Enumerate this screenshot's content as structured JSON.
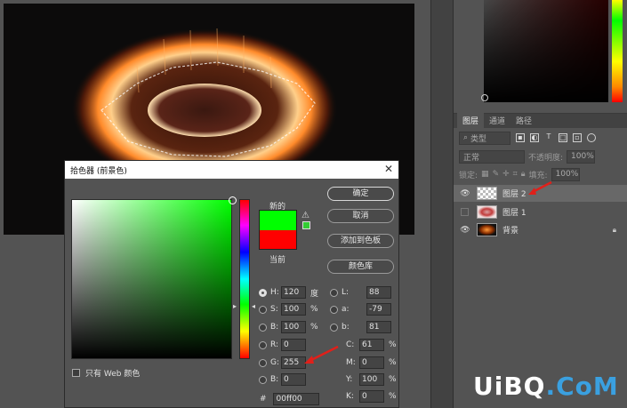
{
  "dialog": {
    "title": "拾色器 (前景色)",
    "close": "✕",
    "label_new": "新的",
    "label_current": "当前",
    "buttons": {
      "ok": "确定",
      "cancel": "取消",
      "add_to_swatches": "添加到色板",
      "color_libraries": "颜色库"
    },
    "web_only_label": "只有 Web 颜色",
    "new_color": "#00ff00",
    "current_color": "#ff0000",
    "fields": {
      "H": {
        "label": "H:",
        "value": "120",
        "unit": "度"
      },
      "S": {
        "label": "S:",
        "value": "100",
        "unit": "%"
      },
      "B": {
        "label": "B:",
        "value": "100",
        "unit": "%"
      },
      "R": {
        "label": "R:",
        "value": "0"
      },
      "G": {
        "label": "G:",
        "value": "255"
      },
      "Bl": {
        "label": "B:",
        "value": "0"
      },
      "L": {
        "label": "L:",
        "value": "88"
      },
      "a": {
        "label": "a:",
        "value": "-79"
      },
      "b": {
        "label": "b:",
        "value": "81"
      },
      "C": {
        "label": "C:",
        "value": "61",
        "unit": "%"
      },
      "M": {
        "label": "M:",
        "value": "0",
        "unit": "%"
      },
      "Y": {
        "label": "Y:",
        "value": "100",
        "unit": "%"
      },
      "K": {
        "label": "K:",
        "value": "0",
        "unit": "%"
      }
    },
    "hex_label": "#",
    "hex_value": "00ff00"
  },
  "layers_panel": {
    "tabs": [
      "图层",
      "通道",
      "路径"
    ],
    "filter_select": "类型",
    "blend_mode": "正常",
    "opacity_label": "不透明度:",
    "opacity_value": "100%",
    "lock_label": "锁定:",
    "fill_label": "填充:",
    "fill_value": "100%",
    "layers": [
      {
        "name": "图层 2"
      },
      {
        "name": "图层 1"
      },
      {
        "name": "背景"
      }
    ]
  },
  "watermark": {
    "part1": "UiBQ",
    "part2": ".CoM"
  },
  "colors": {
    "new_color": "#00ff00",
    "current_color": "#ff0000",
    "annotation_arrow": "#e0201a"
  }
}
